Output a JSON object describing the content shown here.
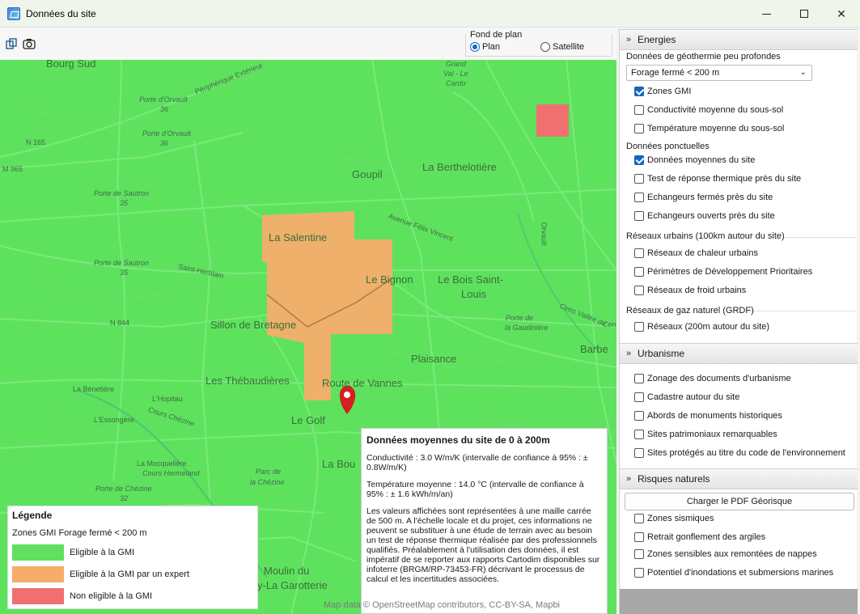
{
  "window": {
    "title": "Données du site"
  },
  "fond_de_plan": {
    "label": "Fond de plan",
    "options": [
      "Plan",
      "Satellite"
    ],
    "selected": "Plan"
  },
  "map": {
    "places": {
      "bourg_sud": "Bourg Sud",
      "grand_val": "Grand",
      "grand_val2": "Val - Le",
      "grand_val3": "Cardo",
      "periph": "Périphérique Extérieur",
      "porte_orvault": "Porte d'Orvault",
      "n36a": "36",
      "porte_orvault2": "Porte d'Orvault",
      "n36b": "36",
      "n165": "N 165",
      "m965": "M 965",
      "goupil": "Goupil",
      "berthelotiere": "La Berthelotière",
      "porte_sautron": "Porte de Sautron",
      "n35a": "35",
      "avenue": "Avenue Félix Vincent",
      "orvault": "Orvault",
      "salentine": "La Salentine",
      "porte_sautron2": "Porte de Sautron",
      "n35b": "35",
      "saint_herblain": "Saint-Herblain",
      "bignon": "Le Bignon",
      "bois_saint": "Le Bois Saint-",
      "louis": "Louis",
      "n844": "N 844",
      "sillon": "Sillon de Bretagne",
      "cens": "Cens Vallée du",
      "cens2": "Cens",
      "porte_gaudiniere": "Porte de",
      "porte_gaudiniere2": "la Gaudinière",
      "barbe": "Barbe",
      "plaisance": "Plaisance",
      "thebaudieres": "Les Thébaudières",
      "route_vannes": "Route de Vannes",
      "benetiere": "La Bénetière",
      "hopitau": "L'Hopitau",
      "chezine": "Cours Chézine",
      "essongere": "L'Essongère",
      "golf": "Le Golf",
      "mocquliere": "La Mocquelière",
      "hermeland": "Cours Hermeland",
      "parc_chezine": "Parc de",
      "parc_chezine2": "la Chézine",
      "porte_chezine": "Porte de Chézine",
      "n32": "32",
      "la_bouvard": "La Bou",
      "moulin": "Moulin du",
      "garotterie": "y-La Garotterie"
    },
    "attribution": "Map data © OpenStreetMap contributors, CC-BY-SA, Mapbi"
  },
  "legend": {
    "title": "Légende",
    "subtitle": "Zones GMI Forage fermé < 200 m",
    "items": [
      {
        "label": "Eligible à la GMI",
        "color": "#5fe05f"
      },
      {
        "label": "Eligible à la GMI par un expert",
        "color": "#f6ad6a"
      },
      {
        "label": "Non eligible à la GMI",
        "color": "#f07070"
      }
    ]
  },
  "popup": {
    "title": "Données moyennes du site de 0 à 200m",
    "conductivity": "Conductivité : 3.0 W/m/K (intervalle de confiance à 95% : ± 0.8W/m/K)",
    "temperature": "Température moyenne : 14.0 °C (intervalle de confiance à 95% : ± 1.6 kWh/m/an)",
    "note": "Les valeurs affichées sont représentées à une maille carrée de 500 m. A l'échelle locale et du projet, ces informations ne peuvent se substituer à une étude de terrain avec au besoin un test de réponse thermique réalisée par des professionnels qualifiés. Préalablement à l'utilisation des données, il est impératif de se reporter aux rapports Cartodim disponibles sur infoterre (BRGM/RP-73453-FR) décrivant le processus de calcul et les incertitudes associées."
  },
  "panel": {
    "energies": {
      "header": "Energies",
      "geothermie_label": "Données de géothermie peu profondes",
      "select_value": "Forage fermé < 200 m",
      "geo_checks": [
        {
          "label": "Zones GMI",
          "checked": true
        },
        {
          "label": "Conductivité moyenne du sous-sol",
          "checked": false
        },
        {
          "label": "Température moyenne du sous-sol",
          "checked": false
        }
      ],
      "ponctuelles_label": "Données ponctuelles",
      "ponct_checks": [
        {
          "label": "Données moyennes du site",
          "checked": true
        },
        {
          "label": "Test de réponse thermique près du site",
          "checked": false
        },
        {
          "label": "Echangeurs fermés près du site",
          "checked": false
        },
        {
          "label": "Echangeurs ouverts près du site",
          "checked": false
        }
      ],
      "reseaux_label": "Réseaux urbains (100km autour du site)",
      "reseaux_checks": [
        {
          "label": "Réseaux de chaleur urbains",
          "checked": false
        },
        {
          "label": "Périmètres de Développement Prioritaires",
          "checked": false
        },
        {
          "label": "Réseaux de froid urbains",
          "checked": false
        }
      ],
      "gaz_label": "Réseaux de gaz naturel (GRDF)",
      "gaz_checks": [
        {
          "label": "Réseaux (200m autour du site)",
          "checked": false
        }
      ]
    },
    "urbanisme": {
      "header": "Urbanisme",
      "checks": [
        {
          "label": "Zonage des documents d'urbanisme",
          "checked": false
        },
        {
          "label": "Cadastre autour du site",
          "checked": false
        },
        {
          "label": "Abords de monuments historiques",
          "checked": false
        },
        {
          "label": "Sites patrimoniaux remarquables",
          "checked": false
        },
        {
          "label": "Sites protégés au titre du code de l'environnement",
          "checked": false
        }
      ]
    },
    "risques": {
      "header": "Risques naturels",
      "button": "Charger le PDF Géorisque",
      "checks": [
        {
          "label": "Zones sismiques",
          "checked": false
        },
        {
          "label": "Retrait gonflement des argiles",
          "checked": false
        },
        {
          "label": "Zones sensibles aux remontées de nappes",
          "checked": false
        },
        {
          "label": "Potentiel d'inondations et submersions marines",
          "checked": false
        }
      ]
    }
  }
}
